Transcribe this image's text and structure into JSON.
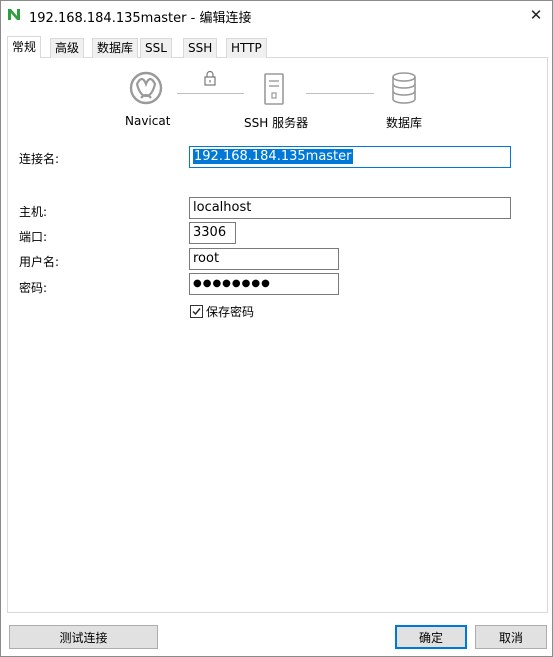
{
  "window": {
    "title": "192.168.184.135master - 编辑连接",
    "close_symbol": "✕"
  },
  "tabs": [
    {
      "label": "常规",
      "active": true
    },
    {
      "label": "高级",
      "active": false
    },
    {
      "label": "数据库",
      "active": false
    },
    {
      "label": "SSL",
      "active": false
    },
    {
      "label": "SSH",
      "active": false
    },
    {
      "label": "HTTP",
      "active": false
    }
  ],
  "diagram": {
    "navicat_label": "Navicat",
    "ssh_label": "SSH 服务器",
    "db_label": "数据库"
  },
  "form": {
    "connection_name_label": "连接名:",
    "connection_name_value": "192.168.184.135master",
    "host_label": "主机:",
    "host_value": "localhost",
    "port_label": "端口:",
    "port_value": "3306",
    "username_label": "用户名:",
    "username_value": "root",
    "password_label": "密码:",
    "password_value": "●●●●●●●●",
    "save_password_label": "保存密码",
    "save_password_checked": true
  },
  "buttons": {
    "test_label": "测试连接",
    "ok_label": "确定",
    "cancel_label": "取消"
  },
  "colors": {
    "accent": "#0078d7",
    "navicat_green": "#2e9e3e"
  }
}
